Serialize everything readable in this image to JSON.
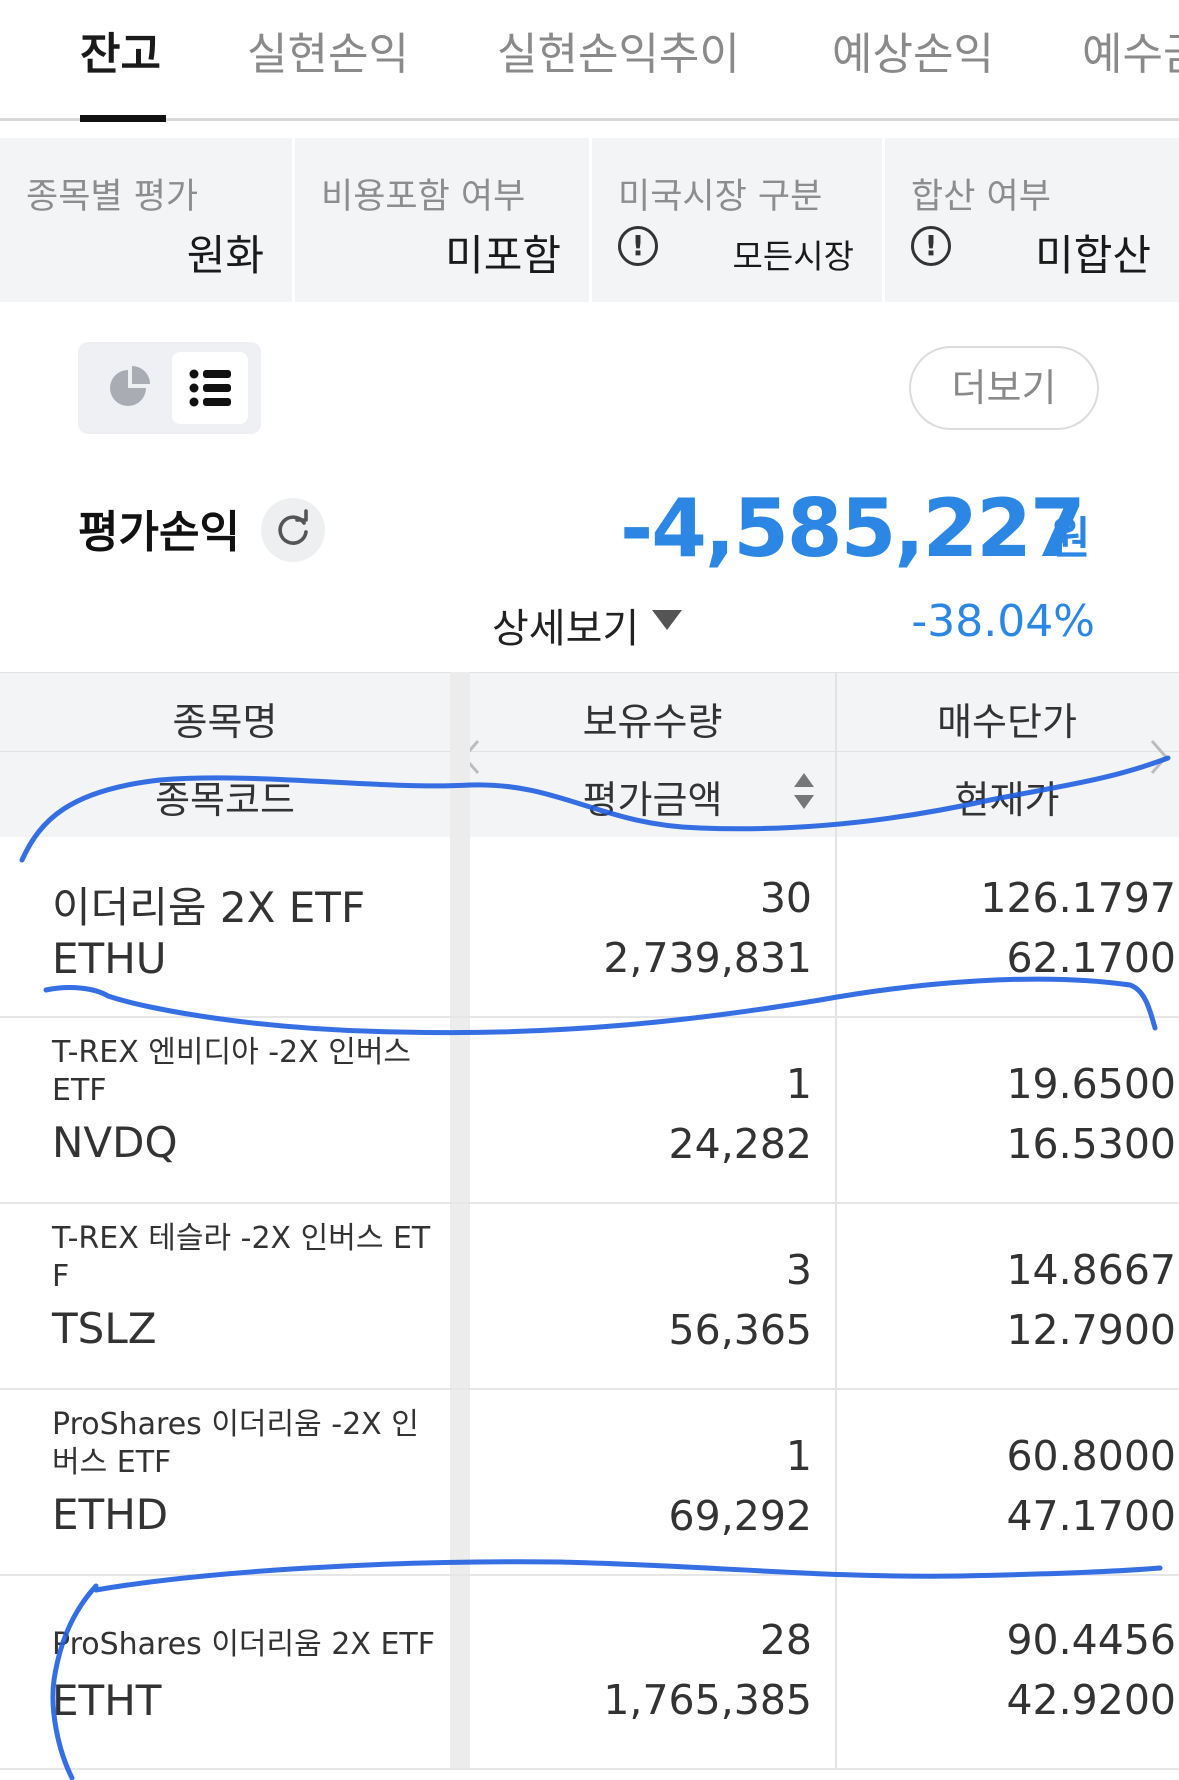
{
  "tabs": [
    {
      "label": "잔고",
      "active": true
    },
    {
      "label": "실현손익",
      "active": false
    },
    {
      "label": "실현손익추이",
      "active": false
    },
    {
      "label": "예상손익",
      "active": false
    },
    {
      "label": "예수금",
      "active": false
    }
  ],
  "filters": [
    {
      "label": "종목별 평가",
      "value": "원화",
      "has_info_icon": false
    },
    {
      "label": "비용포함 여부",
      "value": "미포함",
      "has_info_icon": false
    },
    {
      "label": "미국시장 구분",
      "value": "모든시장",
      "has_info_icon": true
    },
    {
      "label": "합산 여부",
      "value": "미합산",
      "has_info_icon": true
    }
  ],
  "view_toggle": {
    "options": [
      "pie-chart-icon",
      "list-icon"
    ],
    "selected": "list-icon"
  },
  "more_button": "더보기",
  "summary": {
    "label": "평가손익",
    "value": "-4,585,227",
    "unit": "원",
    "detail_label": "상세보기",
    "rate": "-38.04%"
  },
  "table": {
    "headers": {
      "name": "종목명",
      "code": "종목코드",
      "qty": "보유수량",
      "eval": "평가금액",
      "avg_price": "매수단가",
      "cur_price": "현재가"
    },
    "rows": [
      {
        "name": "이더리움 2X ETF",
        "code": "ETHU",
        "qty": "30",
        "eval": "2,739,831",
        "avg_price": "126.1797",
        "cur_price": "62.1700"
      },
      {
        "name": "T-REX 엔비디아 -2X 인버스 ETF",
        "code": "NVDQ",
        "qty": "1",
        "eval": "24,282",
        "avg_price": "19.6500",
        "cur_price": "16.5300"
      },
      {
        "name": "T-REX 테슬라 -2X 인버스 ETF",
        "code": "TSLZ",
        "qty": "3",
        "eval": "56,365",
        "avg_price": "14.8667",
        "cur_price": "12.7900"
      },
      {
        "name": "ProShares 이더리움 -2X 인버스 ETF",
        "code": "ETHD",
        "qty": "1",
        "eval": "69,292",
        "avg_price": "60.8000",
        "cur_price": "47.1700"
      },
      {
        "name": "ProShares 이더리움 2X ETF",
        "code": "ETHT",
        "qty": "28",
        "eval": "1,765,385",
        "avg_price": "90.4456",
        "cur_price": "42.9200"
      }
    ]
  },
  "colors": {
    "accent_blue": "#2b87e3",
    "annotation_ink": "#1f5fe0"
  }
}
